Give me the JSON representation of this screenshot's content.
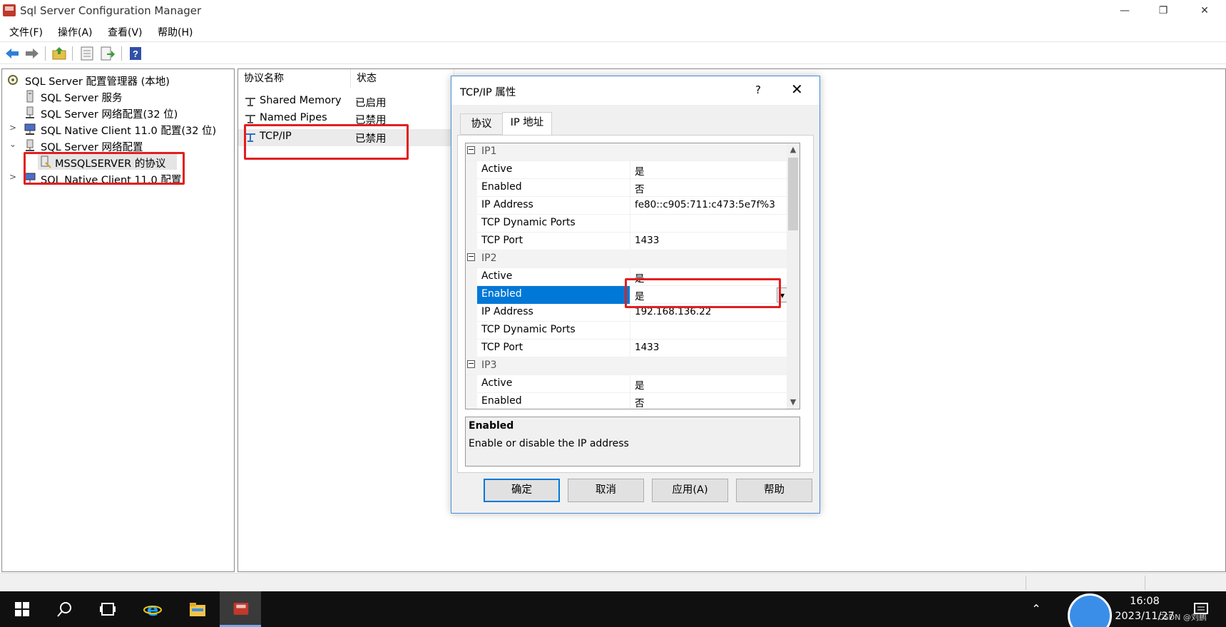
{
  "window": {
    "title": "Sql Server Configuration Manager",
    "minimize": "—",
    "restore": "❐",
    "close": "✕"
  },
  "menu": [
    "文件(F)",
    "操作(A)",
    "查看(V)",
    "帮助(H)"
  ],
  "toolbar_icons": [
    "back-icon",
    "forward-icon",
    "up-folder-icon",
    "properties-icon",
    "export-icon",
    "help-icon"
  ],
  "tree": [
    {
      "label": "SQL Server 配置管理器 (本地)",
      "icon": "config-manager-icon"
    },
    {
      "label": "SQL Server 服务",
      "icon": "server-icon"
    },
    {
      "label": "SQL Server 网络配置(32 位)",
      "icon": "network-icon"
    },
    {
      "label": "SQL Native Client 11.0 配置(32 位)",
      "icon": "client-icon",
      "chevron": ">"
    },
    {
      "label": "SQL Server 网络配置",
      "icon": "network-icon",
      "chevron": "⌄"
    },
    {
      "label": "MSSQLSERVER 的协议",
      "icon": "protocol-icon"
    },
    {
      "label": "SQL Native Client 11.0 配置",
      "icon": "client-icon",
      "chevron": ">"
    }
  ],
  "protocols": {
    "headers": [
      "协议名称",
      "状态"
    ],
    "rows": [
      {
        "name": "Shared Memory",
        "status": "已启用"
      },
      {
        "name": "Named Pipes",
        "status": "已禁用"
      },
      {
        "name": "TCP/IP",
        "status": "已禁用"
      }
    ]
  },
  "dialog": {
    "title": "TCP/IP 属性",
    "help": "?",
    "close": "✕",
    "tabs": [
      "协议",
      "IP 地址"
    ],
    "active_tab": "IP 地址",
    "groups": [
      {
        "name": "IP1",
        "rows": [
          {
            "key": "Active",
            "value": "是"
          },
          {
            "key": "Enabled",
            "value": "否"
          },
          {
            "key": "IP Address",
            "value": "fe80::c905:711:c473:5e7f%3"
          },
          {
            "key": "TCP Dynamic Ports",
            "value": ""
          },
          {
            "key": "TCP Port",
            "value": "1433"
          }
        ]
      },
      {
        "name": "IP2",
        "rows": [
          {
            "key": "Active",
            "value": "是"
          },
          {
            "key": "Enabled",
            "value": "是"
          },
          {
            "key": "IP Address",
            "value": "192.168.136.22"
          },
          {
            "key": "TCP Dynamic Ports",
            "value": ""
          },
          {
            "key": "TCP Port",
            "value": "1433"
          }
        ]
      },
      {
        "name": "IP3",
        "rows": [
          {
            "key": "Active",
            "value": "是"
          },
          {
            "key": "Enabled",
            "value": "否"
          }
        ]
      }
    ],
    "collapse_glyph": "−",
    "description": {
      "title": "Enabled",
      "text": "Enable or disable the IP address"
    },
    "buttons": [
      "确定",
      "取消",
      "应用(A)",
      "帮助"
    ]
  },
  "taskbar": {
    "time": "16:08",
    "date": "2023/11/27",
    "watermark": "CSDN @刘鹏",
    "icons": [
      "windows-start-icon",
      "search-icon",
      "task-view-icon",
      "internet-explorer-icon",
      "file-explorer-icon",
      "sql-config-manager-icon",
      "chevron-up-icon",
      "network-icon",
      "notification-icon"
    ]
  }
}
